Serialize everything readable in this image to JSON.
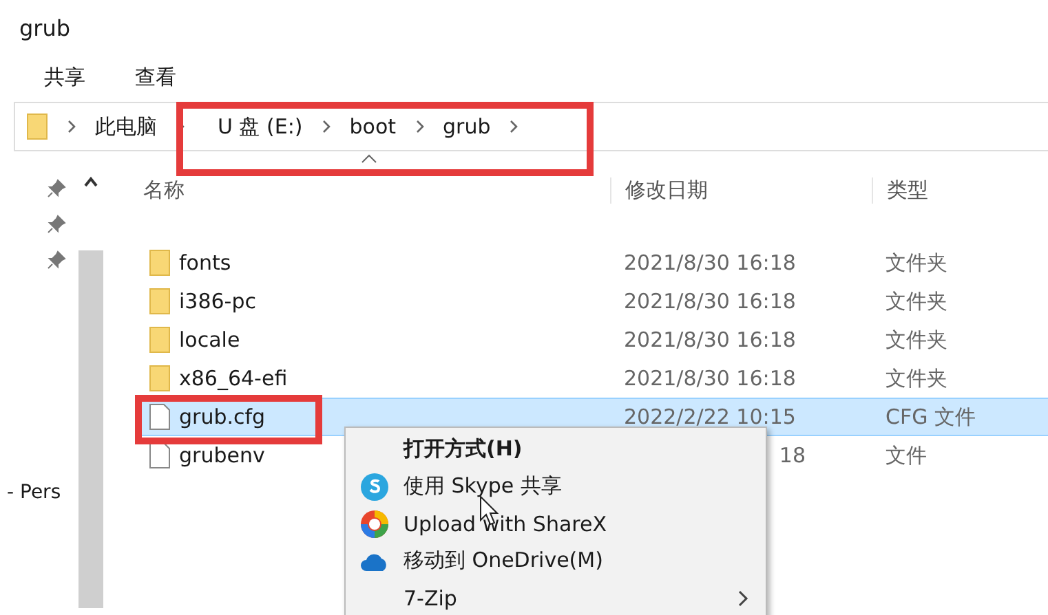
{
  "window": {
    "title": "grub"
  },
  "ribbon_tabs": [
    {
      "label": "共享",
      "selected": false
    },
    {
      "label": "查看",
      "selected": false
    }
  ],
  "address_bar": {
    "segments": [
      "此电脑",
      "U 盘 (E:)",
      "boot",
      "grub"
    ]
  },
  "nav_pane": {
    "pinned": [
      true,
      true,
      true
    ],
    "item": "- Pers"
  },
  "columns": [
    "名称",
    "修改日期",
    "类型"
  ],
  "files": [
    {
      "name": "fonts",
      "kind": "folder",
      "date": "2021/8/30 16:18",
      "type": "文件夹",
      "selected": false,
      "date_hidden": false
    },
    {
      "name": "i386-pc",
      "kind": "folder",
      "date": "2021/8/30 16:18",
      "type": "文件夹",
      "selected": false,
      "date_hidden": false
    },
    {
      "name": "locale",
      "kind": "folder",
      "date": "2021/8/30 16:18",
      "type": "文件夹",
      "selected": false,
      "date_hidden": false
    },
    {
      "name": "x86_64-efi",
      "kind": "folder",
      "date": "2021/8/30 16:18",
      "type": "文件夹",
      "selected": false,
      "date_hidden": false
    },
    {
      "name": "grub.cfg",
      "kind": "file",
      "date": "2022/2/22 10:15",
      "type": "CFG 文件",
      "selected": true,
      "date_hidden": false
    },
    {
      "name": "grubenv",
      "kind": "file",
      "date": "18",
      "type": "文件",
      "selected": false,
      "date_hidden": true
    }
  ],
  "context_menu": [
    {
      "label": "打开方式(H)",
      "kind": "default",
      "submenu": false
    },
    {
      "label": "使用 Skype 共享",
      "kind": "skype",
      "submenu": false
    },
    {
      "label": "Upload with ShareX",
      "kind": "sharex",
      "submenu": false
    },
    {
      "label": "移动到 OneDrive(M)",
      "kind": "onedrive",
      "submenu": false
    },
    {
      "label": "7-Zip",
      "kind": "plain",
      "submenu": true
    }
  ]
}
